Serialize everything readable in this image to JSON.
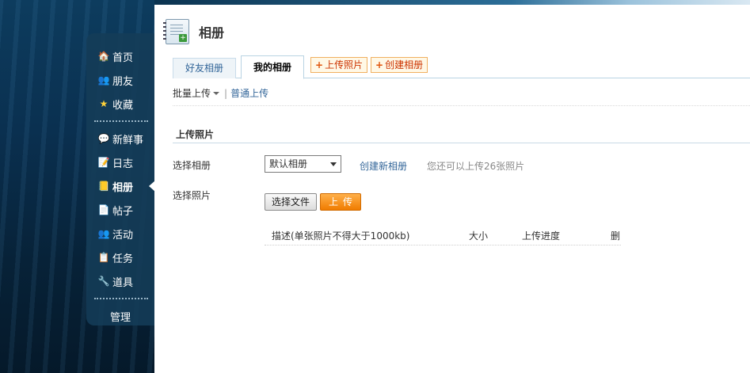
{
  "sidebar": {
    "items": [
      {
        "label": "首页",
        "icon": "home-icon"
      },
      {
        "label": "朋友",
        "icon": "friends-icon"
      },
      {
        "label": "收藏",
        "icon": "star-icon"
      },
      {
        "label": "新鲜事",
        "icon": "speech-bubble-icon"
      },
      {
        "label": "日志",
        "icon": "blog-icon"
      },
      {
        "label": "相册",
        "icon": "album-icon",
        "active": true
      },
      {
        "label": "帖子",
        "icon": "document-icon"
      },
      {
        "label": "活动",
        "icon": "activity-icon"
      },
      {
        "label": "任务",
        "icon": "task-icon"
      },
      {
        "label": "道具",
        "icon": "tool-icon"
      }
    ],
    "manage_label": "管理"
  },
  "header": {
    "title": "相册",
    "icon": "photo-album-icon"
  },
  "tabs": [
    {
      "label": "好友相册",
      "active": false
    },
    {
      "label": "我的相册",
      "active": true
    }
  ],
  "actions": {
    "upload_label": "上传照片",
    "create_label": "创建相册"
  },
  "subnav": {
    "batch_label": "批量上传",
    "separator": "|",
    "normal_label": "普通上传"
  },
  "section": {
    "title": "上传照片"
  },
  "form": {
    "album_label": "选择相册",
    "album_selected": "默认相册",
    "create_album_link": "创建新相册",
    "hint": "您还可以上传26张照片",
    "photo_label": "选择照片",
    "choose_file_label": "选择文件",
    "upload_label": "上传"
  },
  "table": {
    "columns": [
      "描述(单张照片不得大于1000kb)",
      "大小",
      "上传进度",
      "删"
    ]
  },
  "colors": {
    "accent_orange": "#f07c00",
    "link_blue": "#336699",
    "sidebar_bg": "#143c58"
  }
}
